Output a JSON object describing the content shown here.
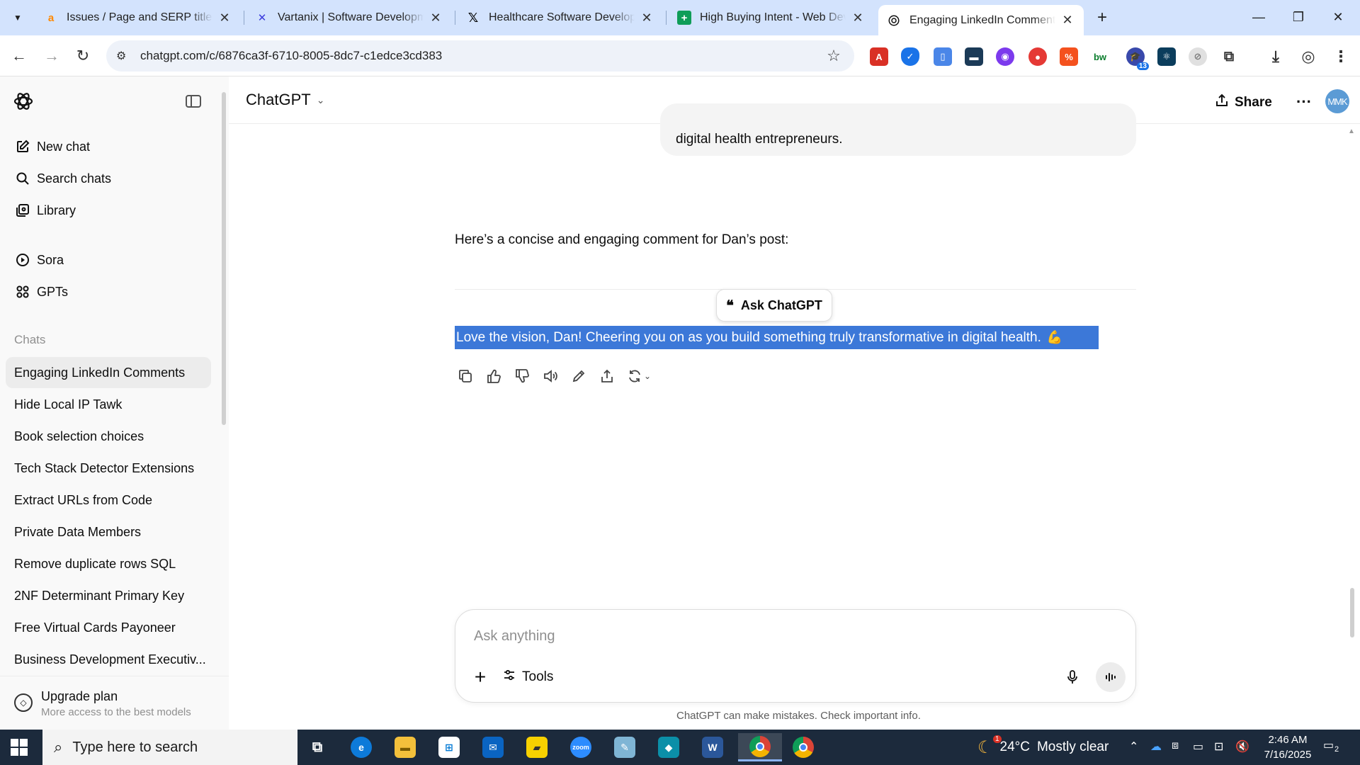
{
  "browser": {
    "tabs": [
      {
        "title": "Issues / Page and SERP titles do",
        "favicon": "ahrefs-a",
        "color": "#ff8800"
      },
      {
        "title": "Vartanix | Software Development",
        "favicon": "vartanix-x",
        "color": "#3b3bdc"
      },
      {
        "title": "Healthcare Software Development",
        "favicon": "x-logo",
        "color": "#000000"
      },
      {
        "title": "High Buying Intent - Web Deve",
        "favicon": "sheets-plus",
        "color": "#0f9d58"
      },
      {
        "title": "Engaging LinkedIn Comments",
        "favicon": "openai-logo",
        "color": "#000000",
        "active": true
      }
    ],
    "url": "chatgpt.com/c/6876ca3f-6710-8005-8dc7-c1edce3cd383",
    "extension_badge": "13"
  },
  "sidebar": {
    "actions": [
      {
        "label": "New chat",
        "icon": "new-chat-icon"
      },
      {
        "label": "Search chats",
        "icon": "search-icon"
      },
      {
        "label": "Library",
        "icon": "library-icon"
      },
      {
        "label": "Sora",
        "icon": "sora-play-icon"
      },
      {
        "label": "GPTs",
        "icon": "gpts-grid-icon"
      }
    ],
    "chats_heading": "Chats",
    "chats": [
      "Engaging LinkedIn Comments",
      "Hide Local IP Tawk",
      "Book selection choices",
      "Tech Stack Detector Extensions",
      "Extract URLs from Code",
      "Private Data Members",
      "Remove duplicate rows SQL",
      "2NF Determinant Primary Key",
      "Free Virtual Cards Payoneer",
      "Business Development Executiv..."
    ],
    "upgrade": {
      "title": "Upgrade plan",
      "subtitle": "More access to the best models"
    }
  },
  "header": {
    "model": "ChatGPT",
    "share": "Share",
    "avatar": "MMK"
  },
  "conversation": {
    "user_bubble_tail": "digital health entrepreneurs.",
    "assistant_intro": "Here’s a concise and engaging comment for Dan’s post:",
    "ask_chatgpt": "Ask ChatGPT",
    "selected_comment": "Love the vision, Dan! Cheering you on as you build something truly transformative in digital health.",
    "selected_comment_emoji": "💪"
  },
  "composer": {
    "placeholder": "Ask anything",
    "tools": "Tools"
  },
  "disclaimer": "ChatGPT can make mistakes. Check important info.",
  "taskbar": {
    "search_placeholder": "Type here to search",
    "weather_temp": "24°C",
    "weather_desc": "Mostly clear",
    "weather_badge": "1",
    "time": "2:46 AM",
    "date": "7/16/2025",
    "notification_count": "2"
  }
}
